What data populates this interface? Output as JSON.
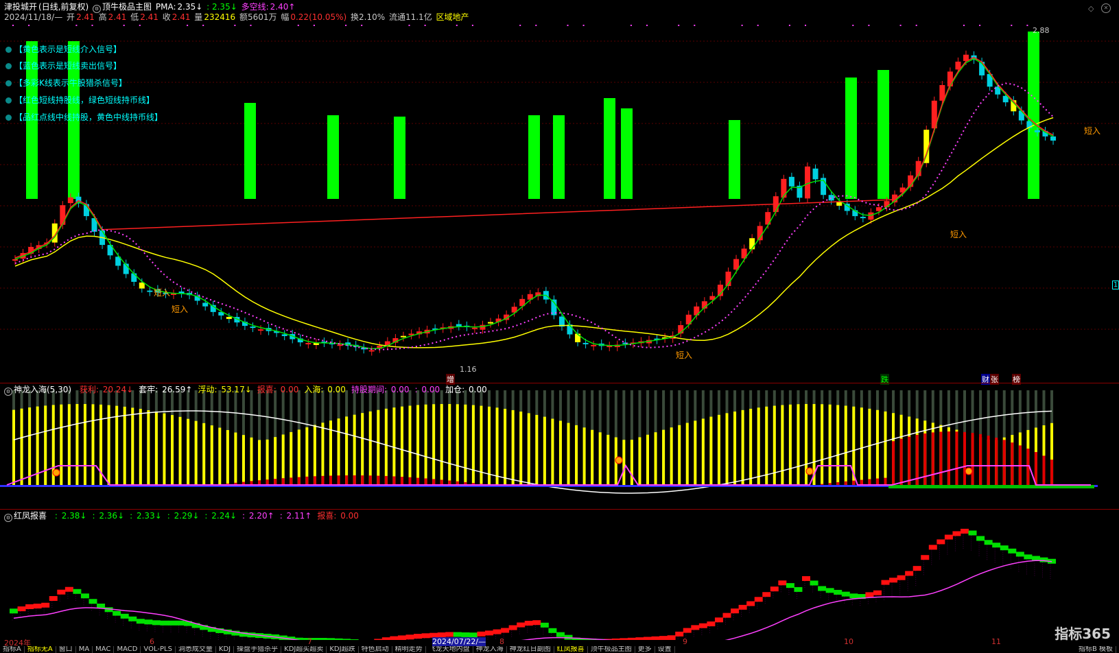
{
  "main": {
    "stock_name": "津投城开",
    "period": "(日线,前复权)",
    "indicator": "顶牛极品主图",
    "pma_label": "PMA:",
    "pma_value": "2.35↓",
    "pma2": ": 2.35↓",
    "dkx_label": "多空线:",
    "dkx_value": "2.40↑",
    "info": {
      "date": "2024/11/18/—",
      "open_l": "开",
      "open": "2.41",
      "high_l": "高",
      "high": "2.41",
      "low_l": "低",
      "low": "2.41",
      "close_l": "收",
      "close": "2.41",
      "vol_l": "量",
      "vol": "232416",
      "amt": "额5601万",
      "chg_l": "幅",
      "chg": "0.22(10.05%)",
      "turn": "换2.10%",
      "float": "流通11.1亿",
      "sector": "区域地产"
    },
    "legend": [
      "【黄色表示是短线介入信号】",
      "【蓝色表示是短线卖出信号】",
      "【多彩K线表示牛股猎杀信号】",
      "【红色短线持股线，绿色短线持币线】",
      "【品红点线中线持股，黄色中线持币线】"
    ],
    "annotations": {
      "buy": "短入",
      "high_mark": "2.88",
      "low_mark": "1.16",
      "zeng": "增",
      "die": "跌",
      "cai": "财",
      "zhang": "张",
      "bang": "榜"
    },
    "right_mark": "1"
  },
  "sub1": {
    "name": "神龙入海(5,30)",
    "items": [
      {
        "label": "获利:",
        "value": "20.24↓",
        "color": "#ff3030"
      },
      {
        "label": "套牢:",
        "value": "26.59↑",
        "color": "#ffffff"
      },
      {
        "label": "浮动:",
        "value": "53.17↓",
        "color": "#ffff00"
      },
      {
        "label": "报喜:",
        "value": "0.00",
        "color": "#ff3030"
      },
      {
        "label": "入海:",
        "value": "0.00",
        "color": "#ffff00"
      },
      {
        "label": "持股期间:",
        "value": "0.00",
        "color": "#ff40ff"
      },
      {
        "label": ":",
        "value": "0.00",
        "color": "#ff40ff"
      },
      {
        "label": "加仓:",
        "value": "0.00",
        "color": "#ffffff"
      }
    ]
  },
  "sub2": {
    "name": "红凤报喜",
    "items": [
      {
        "label": ":",
        "value": "2.38↓",
        "color": "#00ff00"
      },
      {
        "label": ":",
        "value": "2.36↓",
        "color": "#00ff00"
      },
      {
        "label": ":",
        "value": "2.33↓",
        "color": "#00ff00"
      },
      {
        "label": ":",
        "value": "2.29↓",
        "color": "#00ff00"
      },
      {
        "label": ":",
        "value": "2.24↓",
        "color": "#00ff00"
      },
      {
        "label": ":",
        "value": "2.20↑",
        "color": "#ff40ff"
      },
      {
        "label": ":",
        "value": "2.11↑",
        "color": "#ff40ff"
      },
      {
        "label": "报喜:",
        "value": "0.00",
        "color": "#ff3030"
      }
    ]
  },
  "xaxis": [
    "2024年",
    "6",
    "7",
    "2024/07/22/—",
    "8",
    "9",
    "10",
    "11"
  ],
  "tabs": [
    "指标A",
    "指标无A",
    "窗口",
    "MA",
    "MAC",
    "MACD",
    "VOL-PLS",
    "洞悉成交量",
    "KDJ",
    "操盘手猎杀乎",
    "KDJ超买超卖",
    "KDJ超跌",
    "特色启动",
    "精明走势",
    "飞龙天地内盘",
    "神龙入海",
    "神龙红日副图",
    "红凤报喜",
    "顶牛极品主图",
    "更多",
    "设置"
  ],
  "tabs_right": "指标B 模板",
  "watermark": "指标365",
  "colors": {
    "up": "#ff2020",
    "down": "#00d0e0",
    "bar": "#00ff00",
    "yellow": "#ffff00",
    "magenta": "#ff40ff"
  }
}
